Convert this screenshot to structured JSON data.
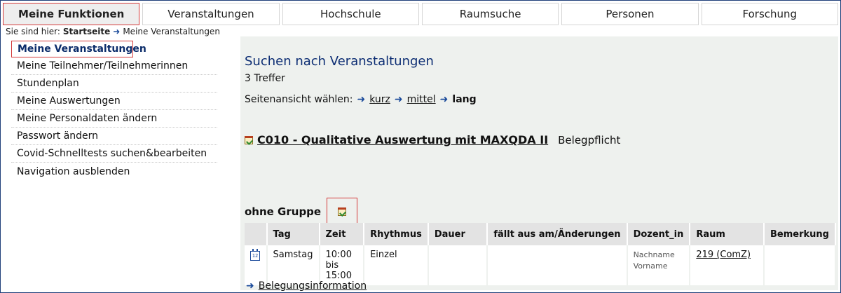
{
  "tabs": [
    "Meine Funktionen",
    "Veranstaltungen",
    "Hochschule",
    "Raumsuche",
    "Personen",
    "Forschung"
  ],
  "breadcrumb": {
    "prefix": "Sie sind hier:",
    "home": "Startseite",
    "current": "Meine Veranstaltungen"
  },
  "sidebar": {
    "items": [
      "Meine Veranstaltungen",
      "Meine Teilnehmer/Teilnehmerinnen",
      "Stundenplan",
      "Meine Auswertungen",
      "Meine Personaldaten ändern",
      "Passwort ändern",
      "Covid-Schnelltests suchen&bearbeiten",
      "Navigation ausblenden"
    ]
  },
  "main": {
    "heading": "Suchen nach Veranstaltungen",
    "hits": "3 Treffer",
    "view": {
      "label": "Seitenansicht wählen:",
      "short": "kurz",
      "medium": "mittel",
      "long": "lang"
    },
    "course": {
      "title": "C010 -  Qualitative Auswertung mit MAXQDA II",
      "note": "Belegpflicht"
    },
    "group_label": "ohne Gruppe",
    "table": {
      "headers": [
        "Tag",
        "Zeit",
        "Rhythmus",
        "Dauer",
        "fällt aus am/Änderungen",
        "Dozent_in",
        "Raum",
        "Bemerkung"
      ],
      "row": {
        "date_icon": "12",
        "tag": "Samstag",
        "zeit_line1": "10:00 bis",
        "zeit_line2": "15:00",
        "rhythmus": "Einzel",
        "dauer": "",
        "aenderungen": "",
        "dozent_line1": "Nachname",
        "dozent_line2": "Vorname",
        "raum": "219 (ComZ)",
        "bemerkung": ""
      }
    },
    "beleg_link": "Belegungsinformation"
  },
  "icons": {
    "arrow": "arrow-right-icon",
    "calendar_check": "calendar-check-icon",
    "calendar_date": "calendar-date-icon"
  }
}
